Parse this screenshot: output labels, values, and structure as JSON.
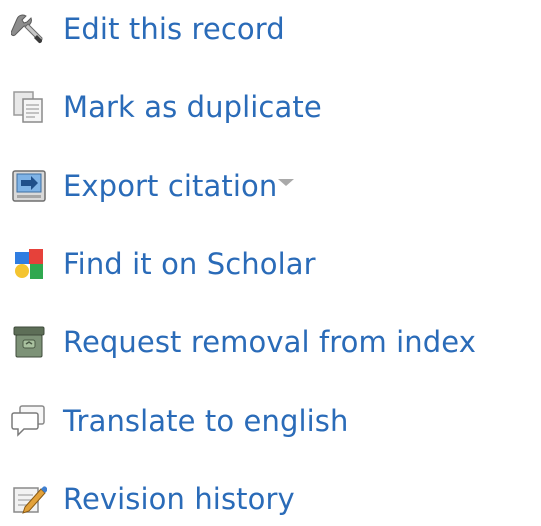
{
  "menu": {
    "items": [
      {
        "label": "Edit this record",
        "icon": "tools-icon"
      },
      {
        "label": "Mark as duplicate",
        "icon": "duplicate-icon"
      },
      {
        "label": "Export citation",
        "icon": "export-icon",
        "has_dropdown": true
      },
      {
        "label": "Find it on Scholar",
        "icon": "google-scholar-icon"
      },
      {
        "label": "Request removal from index",
        "icon": "archive-icon"
      },
      {
        "label": "Translate to english",
        "icon": "speech-bubble-icon"
      },
      {
        "label": "Revision history",
        "icon": "revision-history-icon"
      }
    ]
  },
  "colors": {
    "link": "#2a6bb8",
    "caret": "#a9a9a9"
  }
}
